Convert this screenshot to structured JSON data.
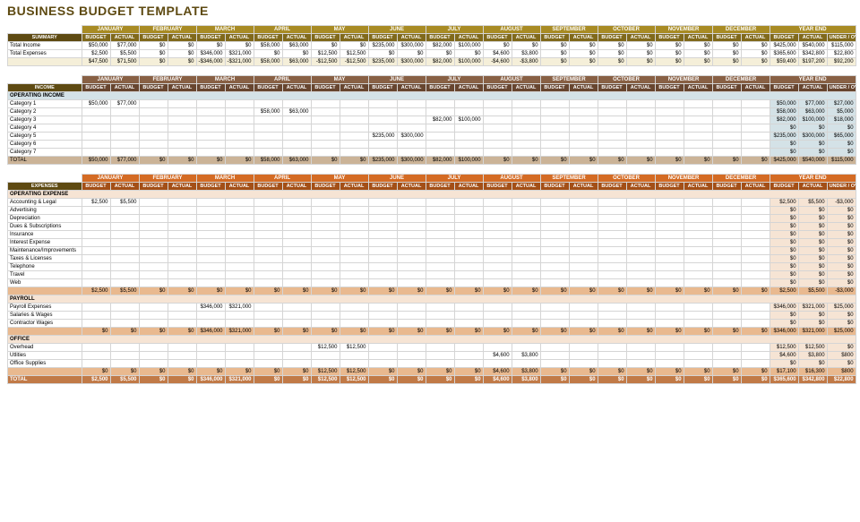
{
  "title": "BUSINESS BUDGET TEMPLATE",
  "months": [
    "JANUARY",
    "FEBRUARY",
    "MARCH",
    "APRIL",
    "MAY",
    "JUNE",
    "JULY",
    "AUGUST",
    "SEPTEMBER",
    "OCTOBER",
    "NOVEMBER",
    "DECEMBER"
  ],
  "yearend": "YEAR END",
  "colpair": [
    "BUDGET",
    "ACTUAL"
  ],
  "underover": "UNDER / OVER",
  "summary": {
    "label": "SUMMARY",
    "rows": [
      {
        "label": "Total Income",
        "v": [
          "$50,000",
          "$77,000",
          "$0",
          "$0",
          "$0",
          "$0",
          "$58,000",
          "$63,000",
          "$0",
          "$0",
          "$235,000",
          "$300,000",
          "$82,000",
          "$100,000",
          "$0",
          "$0",
          "$0",
          "$0",
          "$0",
          "$0",
          "$0",
          "$0",
          "$0",
          "$0",
          "$425,000",
          "$540,000",
          "$115,000"
        ]
      },
      {
        "label": "Total Expenses",
        "v": [
          "$2,500",
          "$5,500",
          "$0",
          "$0",
          "$346,000",
          "$321,000",
          "$0",
          "$0",
          "$12,500",
          "$12,500",
          "$0",
          "$0",
          "$0",
          "$0",
          "$4,600",
          "$3,800",
          "$0",
          "$0",
          "$0",
          "$0",
          "$0",
          "$0",
          "$0",
          "$0",
          "$365,600",
          "$342,800",
          "$22,800"
        ]
      }
    ],
    "total": [
      "$47,500",
      "$71,500",
      "$0",
      "$0",
      "-$346,000",
      "-$321,000",
      "$58,000",
      "$63,000",
      "-$12,500",
      "-$12,500",
      "$235,000",
      "$300,000",
      "$82,000",
      "$100,000",
      "-$4,600",
      "-$3,800",
      "$0",
      "$0",
      "$0",
      "$0",
      "$0",
      "$0",
      "$0",
      "$0",
      "$59,400",
      "$197,200",
      "$92,200"
    ]
  },
  "income": {
    "label": "INCOME",
    "group": "OPERATING INCOME",
    "rows": [
      {
        "label": "Category 1",
        "v": [
          "$50,000",
          "$77,000",
          "",
          "",
          "",
          "",
          "",
          "",
          "",
          "",
          "",
          "",
          "",
          "",
          "",
          "",
          "",
          "",
          "",
          "",
          "",
          "",
          "",
          "",
          "$50,000",
          "$77,000",
          "$27,000"
        ]
      },
      {
        "label": "Category 2",
        "v": [
          "",
          "",
          "",
          "",
          "",
          "",
          "$58,000",
          "$63,000",
          "",
          "",
          "",
          "",
          "",
          "",
          "",
          "",
          "",
          "",
          "",
          "",
          "",
          "",
          "",
          "",
          "$58,000",
          "$63,000",
          "$5,000"
        ]
      },
      {
        "label": "Category 3",
        "v": [
          "",
          "",
          "",
          "",
          "",
          "",
          "",
          "",
          "",
          "",
          "",
          "",
          "$82,000",
          "$100,000",
          "",
          "",
          "",
          "",
          "",
          "",
          "",
          "",
          "",
          "",
          "$82,000",
          "$100,000",
          "$18,000"
        ]
      },
      {
        "label": "Category 4",
        "v": [
          "",
          "",
          "",
          "",
          "",
          "",
          "",
          "",
          "",
          "",
          "",
          "",
          "",
          "",
          "",
          "",
          "",
          "",
          "",
          "",
          "",
          "",
          "",
          "",
          "$0",
          "$0",
          "$0"
        ]
      },
      {
        "label": "Category 5",
        "v": [
          "",
          "",
          "",
          "",
          "",
          "",
          "",
          "",
          "",
          "",
          "$235,000",
          "$300,000",
          "",
          "",
          "",
          "",
          "",
          "",
          "",
          "",
          "",
          "",
          "",
          "",
          "$235,000",
          "$300,000",
          "$65,000"
        ]
      },
      {
        "label": "Category 6",
        "v": [
          "",
          "",
          "",
          "",
          "",
          "",
          "",
          "",
          "",
          "",
          "",
          "",
          "",
          "",
          "",
          "",
          "",
          "",
          "",
          "",
          "",
          "",
          "",
          "",
          "$0",
          "$0",
          "$0"
        ]
      },
      {
        "label": "Category 7",
        "v": [
          "",
          "",
          "",
          "",
          "",
          "",
          "",
          "",
          "",
          "",
          "",
          "",
          "",
          "",
          "",
          "",
          "",
          "",
          "",
          "",
          "",
          "",
          "",
          "",
          "$0",
          "$0",
          "$0"
        ]
      }
    ],
    "total": {
      "label": "TOTAL",
      "v": [
        "$50,000",
        "$77,000",
        "$0",
        "$0",
        "$0",
        "$0",
        "$58,000",
        "$63,000",
        "$0",
        "$0",
        "$235,000",
        "$300,000",
        "$82,000",
        "$100,000",
        "$0",
        "$0",
        "$0",
        "$0",
        "$0",
        "$0",
        "$0",
        "$0",
        "$0",
        "$0",
        "$425,000",
        "$540,000",
        "$115,000"
      ]
    }
  },
  "expenses": {
    "label": "EXPENSES",
    "groups": [
      {
        "name": "OPERATING EXPENSE",
        "rows": [
          {
            "label": "Accounting & Legal",
            "v": [
              "$2,500",
              "$5,500",
              "",
              "",
              "",
              "",
              "",
              "",
              "",
              "",
              "",
              "",
              "",
              "",
              "",
              "",
              "",
              "",
              "",
              "",
              "",
              "",
              "",
              "",
              "$2,500",
              "$5,500",
              "-$3,000"
            ]
          },
          {
            "label": "Advertising",
            "v": [
              "",
              "",
              "",
              "",
              "",
              "",
              "",
              "",
              "",
              "",
              "",
              "",
              "",
              "",
              "",
              "",
              "",
              "",
              "",
              "",
              "",
              "",
              "",
              "",
              "$0",
              "$0",
              "$0"
            ]
          },
          {
            "label": "Depreciation",
            "v": [
              "",
              "",
              "",
              "",
              "",
              "",
              "",
              "",
              "",
              "",
              "",
              "",
              "",
              "",
              "",
              "",
              "",
              "",
              "",
              "",
              "",
              "",
              "",
              "",
              "$0",
              "$0",
              "$0"
            ]
          },
          {
            "label": "Dues & Subscriptions",
            "v": [
              "",
              "",
              "",
              "",
              "",
              "",
              "",
              "",
              "",
              "",
              "",
              "",
              "",
              "",
              "",
              "",
              "",
              "",
              "",
              "",
              "",
              "",
              "",
              "",
              "$0",
              "$0",
              "$0"
            ]
          },
          {
            "label": "Insurance",
            "v": [
              "",
              "",
              "",
              "",
              "",
              "",
              "",
              "",
              "",
              "",
              "",
              "",
              "",
              "",
              "",
              "",
              "",
              "",
              "",
              "",
              "",
              "",
              "",
              "",
              "$0",
              "$0",
              "$0"
            ]
          },
          {
            "label": "Interest Expense",
            "v": [
              "",
              "",
              "",
              "",
              "",
              "",
              "",
              "",
              "",
              "",
              "",
              "",
              "",
              "",
              "",
              "",
              "",
              "",
              "",
              "",
              "",
              "",
              "",
              "",
              "$0",
              "$0",
              "$0"
            ]
          },
          {
            "label": "Maintenance/Improvements",
            "v": [
              "",
              "",
              "",
              "",
              "",
              "",
              "",
              "",
              "",
              "",
              "",
              "",
              "",
              "",
              "",
              "",
              "",
              "",
              "",
              "",
              "",
              "",
              "",
              "",
              "$0",
              "$0",
              "$0"
            ]
          },
          {
            "label": "Taxes & Licenses",
            "v": [
              "",
              "",
              "",
              "",
              "",
              "",
              "",
              "",
              "",
              "",
              "",
              "",
              "",
              "",
              "",
              "",
              "",
              "",
              "",
              "",
              "",
              "",
              "",
              "",
              "$0",
              "$0",
              "$0"
            ]
          },
          {
            "label": "Telephone",
            "v": [
              "",
              "",
              "",
              "",
              "",
              "",
              "",
              "",
              "",
              "",
              "",
              "",
              "",
              "",
              "",
              "",
              "",
              "",
              "",
              "",
              "",
              "",
              "",
              "",
              "$0",
              "$0",
              "$0"
            ]
          },
          {
            "label": "Travel",
            "v": [
              "",
              "",
              "",
              "",
              "",
              "",
              "",
              "",
              "",
              "",
              "",
              "",
              "",
              "",
              "",
              "",
              "",
              "",
              "",
              "",
              "",
              "",
              "",
              "",
              "$0",
              "$0",
              "$0"
            ]
          },
          {
            "label": "Web",
            "v": [
              "",
              "",
              "",
              "",
              "",
              "",
              "",
              "",
              "",
              "",
              "",
              "",
              "",
              "",
              "",
              "",
              "",
              "",
              "",
              "",
              "",
              "",
              "",
              "",
              "$0",
              "$0",
              "$0"
            ]
          }
        ],
        "sub": [
          "$2,500",
          "$5,500",
          "$0",
          "$0",
          "$0",
          "$0",
          "$0",
          "$0",
          "$0",
          "$0",
          "$0",
          "$0",
          "$0",
          "$0",
          "$0",
          "$0",
          "$0",
          "$0",
          "$0",
          "$0",
          "$0",
          "$0",
          "$0",
          "$0",
          "$2,500",
          "$5,500",
          "-$3,000"
        ]
      },
      {
        "name": "PAYROLL",
        "rows": [
          {
            "label": "Payroll Expenses",
            "v": [
              "",
              "",
              "",
              "",
              "$346,000",
              "$321,000",
              "",
              "",
              "",
              "",
              "",
              "",
              "",
              "",
              "",
              "",
              "",
              "",
              "",
              "",
              "",
              "",
              "",
              "",
              "$346,000",
              "$321,000",
              "$25,000"
            ]
          },
          {
            "label": "Salaries & Wages",
            "v": [
              "",
              "",
              "",
              "",
              "",
              "",
              "",
              "",
              "",
              "",
              "",
              "",
              "",
              "",
              "",
              "",
              "",
              "",
              "",
              "",
              "",
              "",
              "",
              "",
              "$0",
              "$0",
              "$0"
            ]
          },
          {
            "label": "Contractor Wages",
            "v": [
              "",
              "",
              "",
              "",
              "",
              "",
              "",
              "",
              "",
              "",
              "",
              "",
              "",
              "",
              "",
              "",
              "",
              "",
              "",
              "",
              "",
              "",
              "",
              "",
              "$0",
              "$0",
              "$0"
            ]
          }
        ],
        "sub": [
          "$0",
          "$0",
          "$0",
          "$0",
          "$346,000",
          "$321,000",
          "$0",
          "$0",
          "$0",
          "$0",
          "$0",
          "$0",
          "$0",
          "$0",
          "$0",
          "$0",
          "$0",
          "$0",
          "$0",
          "$0",
          "$0",
          "$0",
          "$0",
          "$0",
          "$346,000",
          "$321,000",
          "$25,000"
        ]
      },
      {
        "name": "OFFICE",
        "rows": [
          {
            "label": "Overhead",
            "v": [
              "",
              "",
              "",
              "",
              "",
              "",
              "",
              "",
              "$12,500",
              "$12,500",
              "",
              "",
              "",
              "",
              "",
              "",
              "",
              "",
              "",
              "",
              "",
              "",
              "",
              "",
              "$12,500",
              "$12,500",
              "$0"
            ]
          },
          {
            "label": "Utlities",
            "v": [
              "",
              "",
              "",
              "",
              "",
              "",
              "",
              "",
              "",
              "",
              "",
              "",
              "",
              "",
              "$4,600",
              "$3,800",
              "",
              "",
              "",
              "",
              "",
              "",
              "",
              "",
              "$4,600",
              "$3,800",
              "$800"
            ]
          },
          {
            "label": "Office Supplies",
            "v": [
              "",
              "",
              "",
              "",
              "",
              "",
              "",
              "",
              "",
              "",
              "",
              "",
              "",
              "",
              "",
              "",
              "",
              "",
              "",
              "",
              "",
              "",
              "",
              "",
              "$0",
              "$0",
              "$0"
            ]
          }
        ],
        "sub": [
          "$0",
          "$0",
          "$0",
          "$0",
          "$0",
          "$0",
          "$0",
          "$0",
          "$12,500",
          "$12,500",
          "$0",
          "$0",
          "$0",
          "$0",
          "$4,600",
          "$3,800",
          "$0",
          "$0",
          "$0",
          "$0",
          "$0",
          "$0",
          "$0",
          "$0",
          "$17,100",
          "$16,300",
          "$800"
        ]
      }
    ],
    "total": {
      "label": "TOTAL",
      "v": [
        "$2,500",
        "$5,500",
        "$0",
        "$0",
        "$346,000",
        "$321,000",
        "$0",
        "$0",
        "$12,500",
        "$12,500",
        "$0",
        "$0",
        "$0",
        "$0",
        "$4,600",
        "$3,800",
        "$0",
        "$0",
        "$0",
        "$0",
        "$0",
        "$0",
        "$0",
        "$0",
        "$365,600",
        "$342,800",
        "$22,800"
      ]
    }
  }
}
